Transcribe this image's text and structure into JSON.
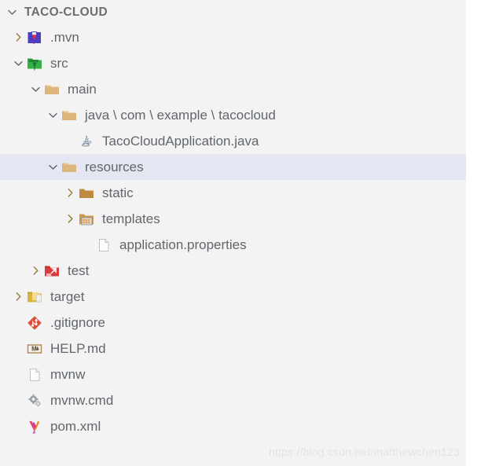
{
  "explorer": {
    "title": "TACO-CLOUD",
    "title_expanded": true,
    "colors": {
      "background": "#f3f3f3",
      "selection": "#e4e6f1",
      "text": "#61666c",
      "title_text": "#6b6d70",
      "folder_tan": "#dcb67a",
      "folder_tan_dark": "#c08b3e",
      "src_green": "#2e9e3e",
      "mvn_blue": "#4b3fc4",
      "test_red": "#d83b3b",
      "target_gold": "#d9b441",
      "git_red": "#e04e39",
      "maven_pink": "#e1467c",
      "markdown_tan": "#b08a5a"
    },
    "items": [
      {
        "name": ".mvn",
        "type": "folder",
        "icon": "folder-mvn-icon",
        "depth": 1,
        "expanded": false,
        "has_twisty": true,
        "selected": false
      },
      {
        "name": "src",
        "type": "folder",
        "icon": "folder-src-icon",
        "depth": 1,
        "expanded": true,
        "has_twisty": true,
        "selected": false
      },
      {
        "name": "main",
        "type": "folder",
        "icon": "folder-open-icon",
        "depth": 2,
        "expanded": true,
        "has_twisty": true,
        "selected": false
      },
      {
        "name": "java \\ com \\ example \\ tacocloud",
        "type": "folder",
        "icon": "folder-open-icon",
        "depth": 3,
        "expanded": true,
        "has_twisty": true,
        "selected": false
      },
      {
        "name": "TacoCloudApplication.java",
        "type": "file",
        "icon": "java-icon",
        "depth": 4,
        "expanded": false,
        "has_twisty": false,
        "selected": false
      },
      {
        "name": "resources",
        "type": "folder",
        "icon": "folder-open-icon",
        "depth": 3,
        "expanded": true,
        "has_twisty": true,
        "selected": true
      },
      {
        "name": "static",
        "type": "folder",
        "icon": "folder-static-icon",
        "depth": 4,
        "expanded": false,
        "has_twisty": true,
        "selected": false
      },
      {
        "name": "templates",
        "type": "folder",
        "icon": "folder-templates-icon",
        "depth": 4,
        "expanded": false,
        "has_twisty": true,
        "selected": false
      },
      {
        "name": "application.properties",
        "type": "file",
        "icon": "file-blank-icon",
        "depth": 5,
        "expanded": false,
        "has_twisty": false,
        "selected": false
      },
      {
        "name": "test",
        "type": "folder",
        "icon": "folder-test-icon",
        "depth": 2,
        "expanded": false,
        "has_twisty": true,
        "selected": false
      },
      {
        "name": "target",
        "type": "folder",
        "icon": "folder-target-icon",
        "depth": 1,
        "expanded": false,
        "has_twisty": true,
        "selected": false
      },
      {
        "name": ".gitignore",
        "type": "file",
        "icon": "git-icon",
        "depth": 1,
        "expanded": false,
        "has_twisty": false,
        "selected": false
      },
      {
        "name": "HELP.md",
        "type": "file",
        "icon": "markdown-icon",
        "depth": 1,
        "expanded": false,
        "has_twisty": false,
        "selected": false
      },
      {
        "name": "mvnw",
        "type": "file",
        "icon": "file-blank-icon",
        "depth": 1,
        "expanded": false,
        "has_twisty": false,
        "selected": false
      },
      {
        "name": "mvnw.cmd",
        "type": "file",
        "icon": "gear-icon",
        "depth": 1,
        "expanded": false,
        "has_twisty": false,
        "selected": false
      },
      {
        "name": "pom.xml",
        "type": "file",
        "icon": "maven-icon",
        "depth": 1,
        "expanded": false,
        "has_twisty": false,
        "selected": false
      }
    ]
  },
  "watermark": {
    "text": "https://blog.csdn.net/matthewchen123"
  }
}
